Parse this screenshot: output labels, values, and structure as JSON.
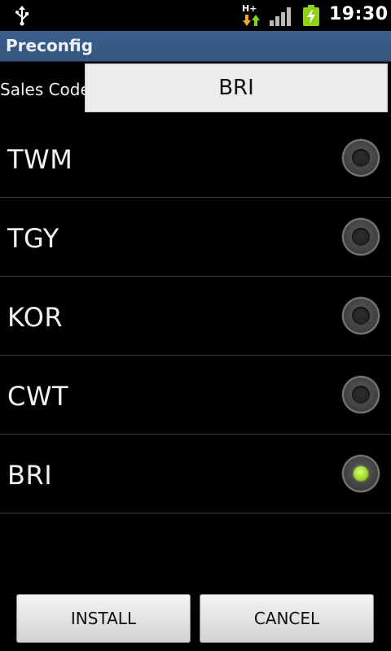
{
  "status_bar": {
    "time": "19:30",
    "network_type": "H+",
    "icons": [
      "usb-icon",
      "hplus-data-icon",
      "signal-icon",
      "battery-charging-icon"
    ]
  },
  "title_bar": {
    "title": "Preconfig"
  },
  "sales_code": {
    "label": "Sales Code",
    "value": "BRI"
  },
  "options": [
    {
      "label": "TWM",
      "selected": false
    },
    {
      "label": "TGY",
      "selected": false
    },
    {
      "label": "KOR",
      "selected": false
    },
    {
      "label": "CWT",
      "selected": false
    },
    {
      "label": "BRI",
      "selected": true
    }
  ],
  "buttons": {
    "install": "INSTALL",
    "cancel": "CANCEL"
  },
  "colors": {
    "title_bar": "#3e5f8c",
    "radio_selected": "#8fd21a",
    "background": "#000000"
  }
}
